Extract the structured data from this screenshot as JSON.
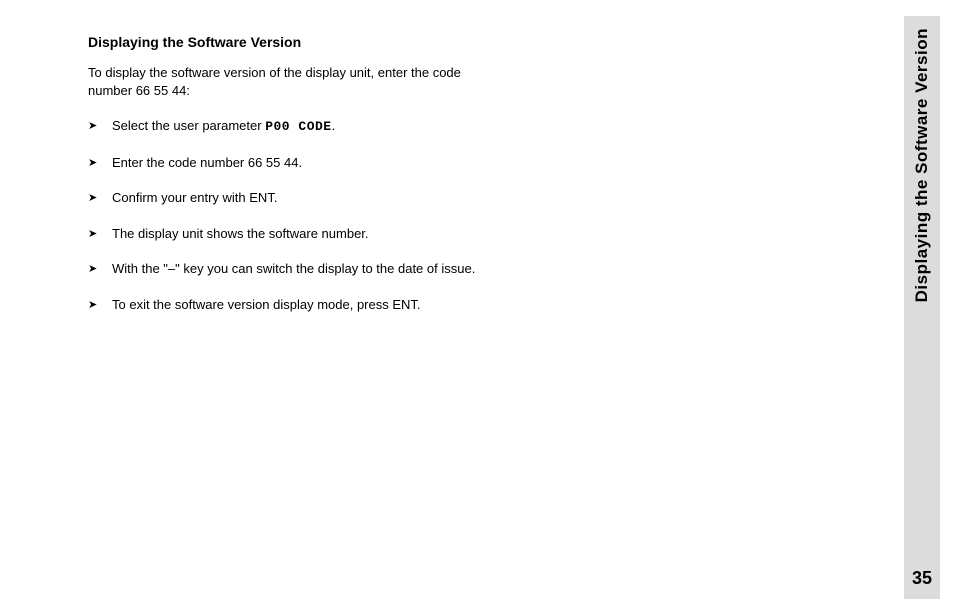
{
  "heading": "Displaying the Software Version",
  "intro": "To display the software version of the display unit, enter the code number 66 55 44:",
  "steps": [
    {
      "pre": "Select the user parameter ",
      "code": "P00 CODE",
      "post": "."
    },
    {
      "pre": "Enter the code number 66 55 44.",
      "code": "",
      "post": ""
    },
    {
      "pre": "Confirm your entry with ENT.",
      "code": "",
      "post": ""
    },
    {
      "pre": "The display unit shows the software number.",
      "code": "",
      "post": ""
    },
    {
      "pre": "With the \"–\" key you can switch the display to the date of issue.",
      "code": "",
      "post": ""
    },
    {
      "pre": "To exit the software version display mode, press ENT.",
      "code": "",
      "post": ""
    }
  ],
  "sideTab": {
    "title": "Displaying the Software Version",
    "pageNumber": "35"
  },
  "bullet": "➤"
}
